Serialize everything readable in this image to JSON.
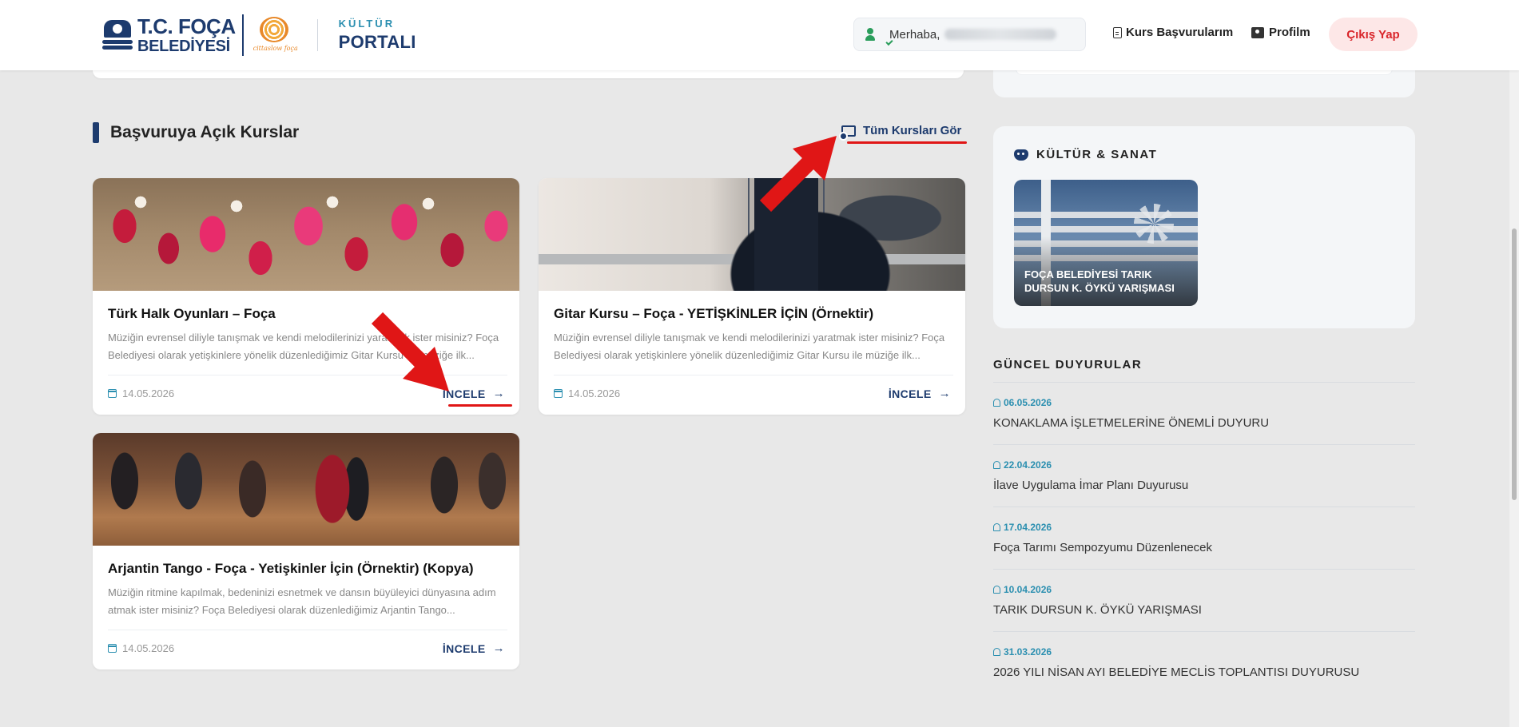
{
  "header": {
    "logo_line1": "T.C. FOÇA",
    "logo_line2": "BELEDİYESİ",
    "logo_tagline": "cittaslow foça",
    "portal_small": "KÜLTÜR",
    "portal_big": "PORTALI",
    "greeting": "Merhaba,",
    "nav_applications": "Kurs Başvurularım",
    "nav_profile": "Profilm",
    "logout": "Çıkış Yap"
  },
  "courses": {
    "section_title": "Başvuruya Açık Kurslar",
    "see_all": "Tüm Kursları Gör",
    "more_label": "İNCELE",
    "items": [
      {
        "title": "Türk Halk Oyunları – Foça",
        "desc": "Müziğin evrensel diliyle tanışmak ve kendi melodilerinizi yaratmak ister misiniz? Foça Belediyesi olarak yetişkinlere yönelik düzenlediğimiz Gitar Kursu ile müziğe ilk...",
        "date": "14.05.2026"
      },
      {
        "title": "Gitar Kursu – Foça - YETİŞKİNLER İÇİN (Örnektir)",
        "desc": "Müziğin evrensel diliyle tanışmak ve kendi melodilerinizi yaratmak ister misiniz? Foça Belediyesi olarak yetişkinlere yönelik düzenlediğimiz Gitar Kursu ile müziğe ilk...",
        "date": "14.05.2026"
      },
      {
        "title": "Arjantin Tango - Foça - Yetişkinler İçin (Örnektir) (Kopya)",
        "desc": "Müziğin ritmine kapılmak, bedeninizi esnetmek ve dansın büyüleyici dünyasına adım atmak ister misiniz? Foça Belediyesi olarak düzenlediğimiz Arjantin Tango...",
        "date": "14.05.2026"
      }
    ]
  },
  "culture": {
    "title": "KÜLTÜR & SANAT",
    "tile_caption": "FOÇA BELEDİYESİ TARIK DURSUN K. ÖYKÜ YARIŞMASI"
  },
  "news": {
    "title": "GÜNCEL DUYURULAR",
    "items": [
      {
        "date": "06.05.2026",
        "title": "KONAKLAMA İŞLETMELERİNE ÖNEMLİ DUYURU"
      },
      {
        "date": "22.04.2026",
        "title": "İlave Uygulama İmar Planı Duyurusu"
      },
      {
        "date": "17.04.2026",
        "title": "Foça Tarımı Sempozyumu Düzenlenecek"
      },
      {
        "date": "10.04.2026",
        "title": "TARIK DURSUN K. ÖYKÜ YARIŞMASI"
      },
      {
        "date": "31.03.2026",
        "title": "2026 YILI NİSAN AYI BELEDİYE MECLİS TOPLANTISI DUYURUSU"
      }
    ]
  },
  "colors": {
    "brand_navy": "#1d3b6e",
    "accent_teal": "#2b8fb0",
    "logout_red": "#d9252a",
    "annotation_red": "#e01616"
  }
}
